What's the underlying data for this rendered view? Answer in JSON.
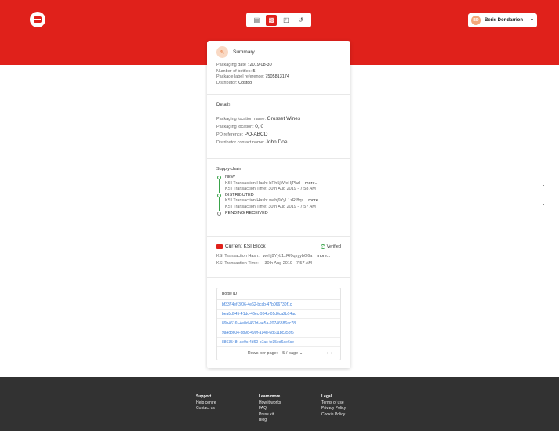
{
  "header": {
    "user_name": "Beric Dondarrion",
    "user_initials": "BD",
    "nav_icons": [
      "chart-icon",
      "bottle-icon",
      "bell-icon",
      "exit-icon"
    ]
  },
  "summary": {
    "title": "Summary",
    "packaging_date_label": "Packaging date :",
    "packaging_date": "2019-08-30",
    "bottles_label": "Number of bottles:",
    "bottles": "5",
    "label_ref_label": "Package label reference:",
    "label_ref": "7505813174",
    "distributor_label": "Distributor:",
    "distributor": "Costco"
  },
  "details": {
    "title": "Details",
    "location_name_label": "Packaging location name:",
    "location_name": "Grosset Wines",
    "location_label": "Packaging location:",
    "location": "0, 0",
    "po_label": "PO reference:",
    "po": "PO-ABCD",
    "contact_label": "Distributor contact name:",
    "contact": "John Doe"
  },
  "supply_chain": {
    "title": "Supply chain",
    "steps": [
      {
        "status": "NEW",
        "hash_label": "KSI Transaction Hash:",
        "hash": "bRh5jWfeHjPkzl",
        "more": "more...",
        "time_label": "KSI Transaction Time:",
        "time": "30th Aug 2019 - 7:58 AM"
      },
      {
        "status": "DISTRIBUTED",
        "hash_label": "KSI Transaction Hash:",
        "hash": "wehj9YyL1zRf8qs",
        "more": "more...",
        "time_label": "KSI Transaction Time:",
        "time": "30th Aug 2019 - 7:57 AM"
      },
      {
        "status": "PENDING RECEIVED"
      }
    ]
  },
  "ksi_block": {
    "title": "Current KSI Block",
    "verified": "Verified",
    "hash_label": "KSI Transaction Hash:",
    "hash": "wehj9YyL1zRf0qsyybG6a",
    "more": "more...",
    "time_label": "KSI Transaction Time:",
    "time": "30th Aug 2019 - 7:57 AM"
  },
  "bottles": {
    "header": "Bottle ID",
    "ids": [
      "bf3374ef-3f06-4e62-bccb-47b066730f1c",
      "bea8d945-41dc-46ec-964b-01d6ca2b14ad",
      "89b4616f-4e0d-467d-ae5a-20746386ac78",
      "9a4cb604-bb9c-490f-a14d-6d611bc35bf6",
      "8863548f-ae9c-4d60-b7ac-fe35ed6ae6ce"
    ],
    "rows_per_page_label": "Rows per page:",
    "rows_per_page": "5 / page"
  },
  "footer": {
    "support": {
      "head": "Support",
      "links": [
        "Help centre",
        "Contact us"
      ]
    },
    "learn": {
      "head": "Learn more",
      "links": [
        "How it works",
        "FAQ",
        "Press kit",
        "Blog"
      ]
    },
    "legal": {
      "head": "Legal",
      "links": [
        "Terms of use",
        "Privacy Policy",
        "Cookie Policy"
      ]
    }
  },
  "colors": {
    "brand_red": "#e0211b",
    "footer_bg": "#323232",
    "link_blue": "#3b7dd8",
    "verified_green": "#3aa34a"
  }
}
